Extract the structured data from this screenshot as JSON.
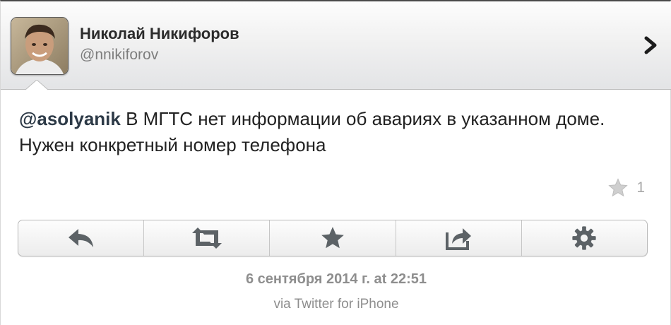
{
  "user": {
    "name": "Николай Никифоров",
    "handle": "@nnikiforov"
  },
  "tweet": {
    "mention": "@asolyanik",
    "text": " В МГТС нет информации об авариях в указанном доме. Нужен конкретный номер телефона",
    "favorite_count": "1"
  },
  "actions": {
    "reply_icon": "reply-icon",
    "retweet_icon": "retweet-icon",
    "favorite_icon": "star-icon",
    "share_icon": "share-icon",
    "settings_icon": "gear-icon"
  },
  "meta": {
    "timestamp": "6 сентября 2014 г. at 22:51",
    "source": "via Twitter for iPhone"
  },
  "colors": {
    "text": "#222222",
    "muted": "#8e8e8e",
    "icon": "#5c6266",
    "star_muted": "#c7c7c7"
  }
}
